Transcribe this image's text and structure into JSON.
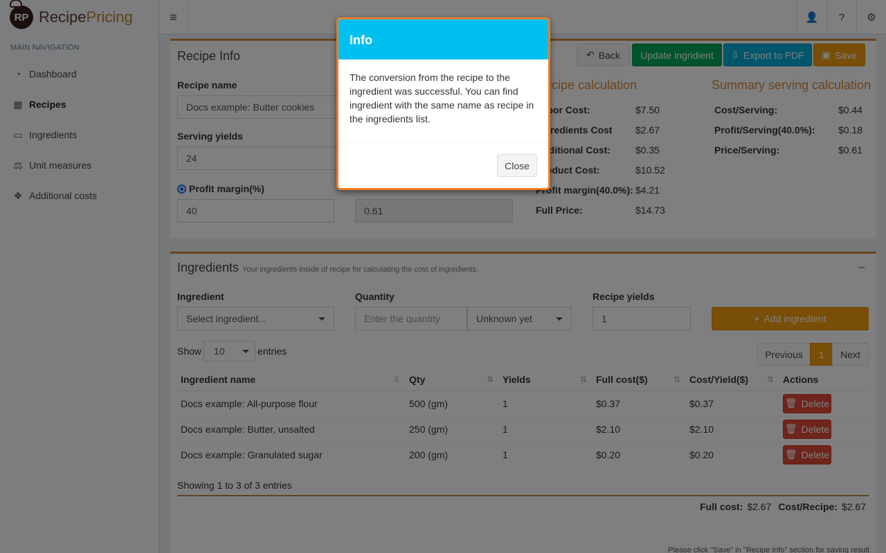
{
  "brand": {
    "badge": "RP",
    "name_a": "Recipe",
    "name_b": "Pricing"
  },
  "nav": {
    "header": "MAIN NAVIGATION",
    "items": [
      {
        "label": "Dashboard",
        "icon": "dashboard-icon"
      },
      {
        "label": "Recipes",
        "icon": "grid-icon"
      },
      {
        "label": "Ingredients",
        "icon": "file-icon"
      },
      {
        "label": "Unit measures",
        "icon": "balance-icon"
      },
      {
        "label": "Additional costs",
        "icon": "cubes-icon"
      }
    ]
  },
  "recipe_info": {
    "title": "Recipe Info",
    "buttons": {
      "back": "Back",
      "update": "Update ingridient",
      "export": "Export to PDF",
      "save": "Save"
    },
    "recipe_name_label": "Recipe name",
    "recipe_name_value": "Docs example: Butter cookies",
    "serving_yields_label": "Serving yields",
    "serving_yields_value": "24",
    "profit_margin_label": "Profit margin(%)",
    "profit_margin_value": "40",
    "price_value": "0.61",
    "recipe_calc": {
      "title": "Recipe calculation",
      "rows": [
        {
          "k": "Labor Cost:",
          "v": "$7.50"
        },
        {
          "k": "Ingredients Cost",
          "v": "$2.67"
        },
        {
          "k": "Additional Cost:",
          "v": "$0.35"
        },
        {
          "k": "Product Cost:",
          "v": "$10.52"
        },
        {
          "k": "Profit margin(40.0%):",
          "v": "$4.21"
        },
        {
          "k": "Full Price:",
          "v": "$14.73"
        }
      ]
    },
    "summary_calc": {
      "title": "Summary serving calculation",
      "rows": [
        {
          "k": "Cost/Serving:",
          "v": "$0.44"
        },
        {
          "k": "Profit/Serving(40.0%):",
          "v": "$0.18"
        },
        {
          "k": "Price/Serving:",
          "v": "$0.61"
        }
      ]
    }
  },
  "ingredients": {
    "title": "Ingredients",
    "subtitle": "Your ingredients inside of recipe for calculating the cost of ingredients.",
    "collapse": "−",
    "ingredient_label": "Ingredient",
    "ingredient_placeholder": "Select ingredient...",
    "quantity_label": "Quantity",
    "quantity_placeholder": "Enter the quantity",
    "unit_value": "Unknown yet",
    "yields_label": "Recipe yields",
    "yields_value": "1",
    "add_button": "Add ingredient",
    "show": "Show",
    "entries_value": "10",
    "entries": "entries",
    "pagination": {
      "prev": "Previous",
      "page": "1",
      "next": "Next"
    },
    "columns": [
      "Ingredient name",
      "Qty",
      "Yields",
      "Full cost($)",
      "Cost/Yield($)",
      "Actions"
    ],
    "rows": [
      {
        "name": "Docs example: All-purpose flour",
        "qty": "500 (gm)",
        "yields": "1",
        "full": "$0.37",
        "per": "$0.37",
        "action": "Delete"
      },
      {
        "name": "Docs example: Butter, unsalted",
        "qty": "250 (gm)",
        "yields": "1",
        "full": "$2.10",
        "per": "$2.10",
        "action": "Delete"
      },
      {
        "name": "Docs example: Granulated sugar",
        "qty": "200 (gm)",
        "yields": "1",
        "full": "$0.20",
        "per": "$0.20",
        "action": "Delete"
      }
    ],
    "showing": "Showing 1 to 3 of 3 entries",
    "full_cost_label": "Full cost:",
    "full_cost_value": "$2.67",
    "cost_recipe_label": "Cost/Recipe:",
    "cost_recipe_value": "$2.67",
    "footer_note": "Please click \"Save\" in \"Recipe Info\" section for saving result"
  },
  "modal": {
    "title": "Info",
    "body": "The conversion from the recipe to the ingredient was successful. You can find ingredient with the same name as recipe in the ingredients list.",
    "close": "Close"
  },
  "colors": {
    "accent": "#d5893c",
    "modal_header": "#00c0ef",
    "modal_border": "#f07b23"
  }
}
